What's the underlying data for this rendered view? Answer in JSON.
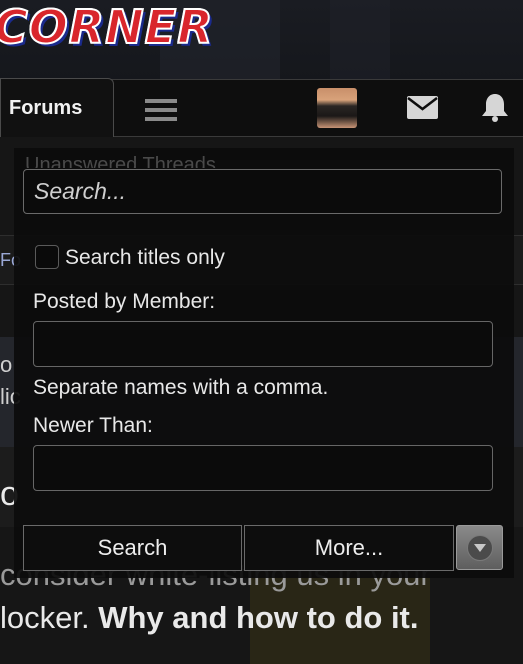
{
  "site": {
    "logo_text": "CORNER"
  },
  "nav": {
    "forums_label": "Forums"
  },
  "background": {
    "notice_prefix": "locker. ",
    "notice_bold": "Why and how to do it.",
    "notice_top": "consider white-listing us in your",
    "left_fragments": [
      "Fo",
      "o",
      "lic",
      "o"
    ]
  },
  "search_popup": {
    "ghost_title": "Unanswered Threads",
    "search_placeholder": "Search...",
    "titles_only_label": "Search titles only",
    "posted_by_label": "Posted by Member:",
    "member_value": "",
    "separate_hint": "Separate names with a comma.",
    "newer_than_label": "Newer Than:",
    "newer_value": "",
    "search_button": "Search",
    "more_button": "More..."
  },
  "colors": {
    "logo_red": "#d9262c",
    "logo_blue": "#1a2a8c",
    "popup_bg": "#0c0c0c",
    "border": "#6a6a6a"
  },
  "icons": [
    "menu-icon",
    "mail-icon",
    "bell-icon",
    "chevron-down-icon"
  ]
}
